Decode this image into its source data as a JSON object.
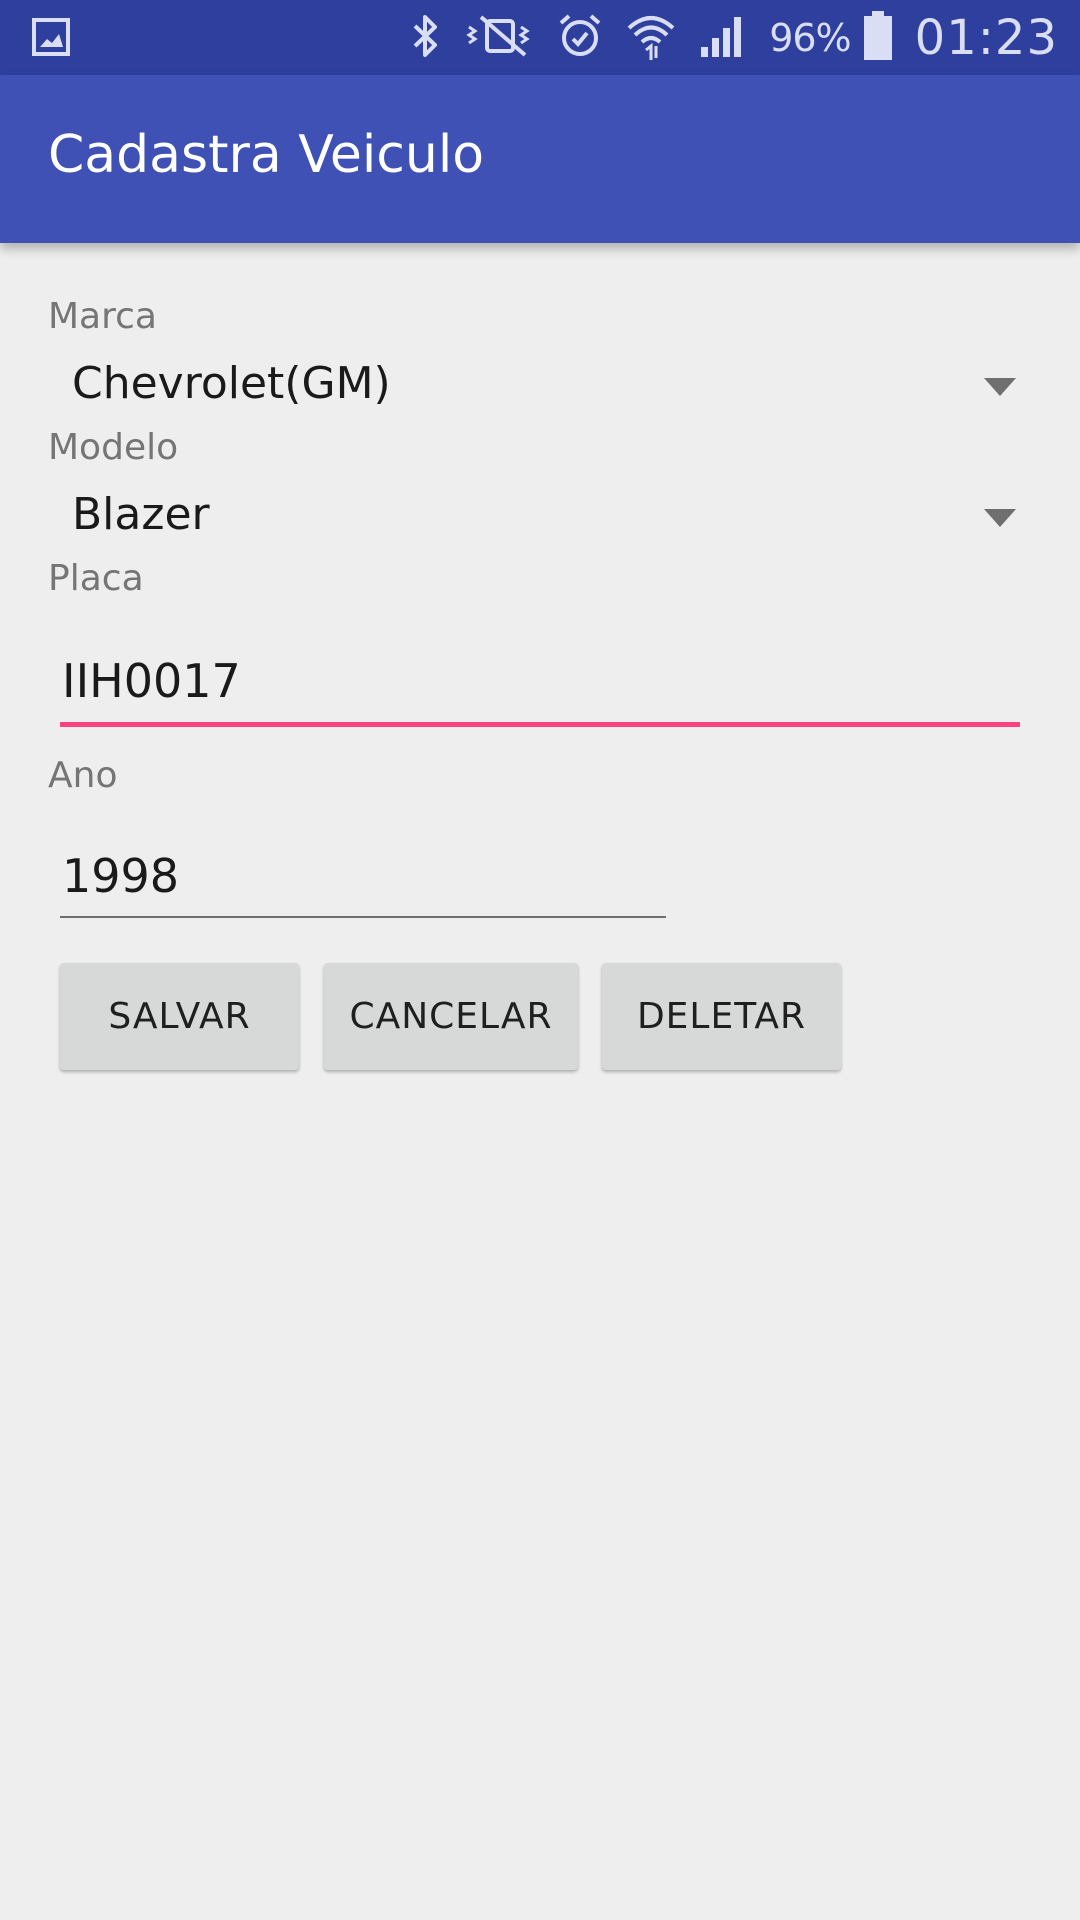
{
  "status_bar": {
    "left_icon": "gallery-icon",
    "icons": [
      "bluetooth-icon",
      "vibrate-mute-icon",
      "alarm-icon",
      "wifi-icon",
      "signal-icon",
      "battery-icon"
    ],
    "battery_percent_text": "96%",
    "battery_level": 0.96,
    "clock": "01:23"
  },
  "app_bar": {
    "title": "Cadastra Veiculo",
    "color": "#3f51b5"
  },
  "form": {
    "marca": {
      "label": "Marca",
      "value": "Chevrolet(GM)"
    },
    "modelo": {
      "label": "Modelo",
      "value": "Blazer"
    },
    "placa": {
      "label": "Placa",
      "value": "IIH0017"
    },
    "ano": {
      "label": "Ano",
      "value": "1998"
    }
  },
  "buttons": {
    "salvar": "SALVAR",
    "cancelar": "CANCELAR",
    "deletar": "DELETAR"
  },
  "colors": {
    "accent": "#ff4081",
    "status_bar": "#2f3f9e",
    "background": "#eeeeef"
  }
}
